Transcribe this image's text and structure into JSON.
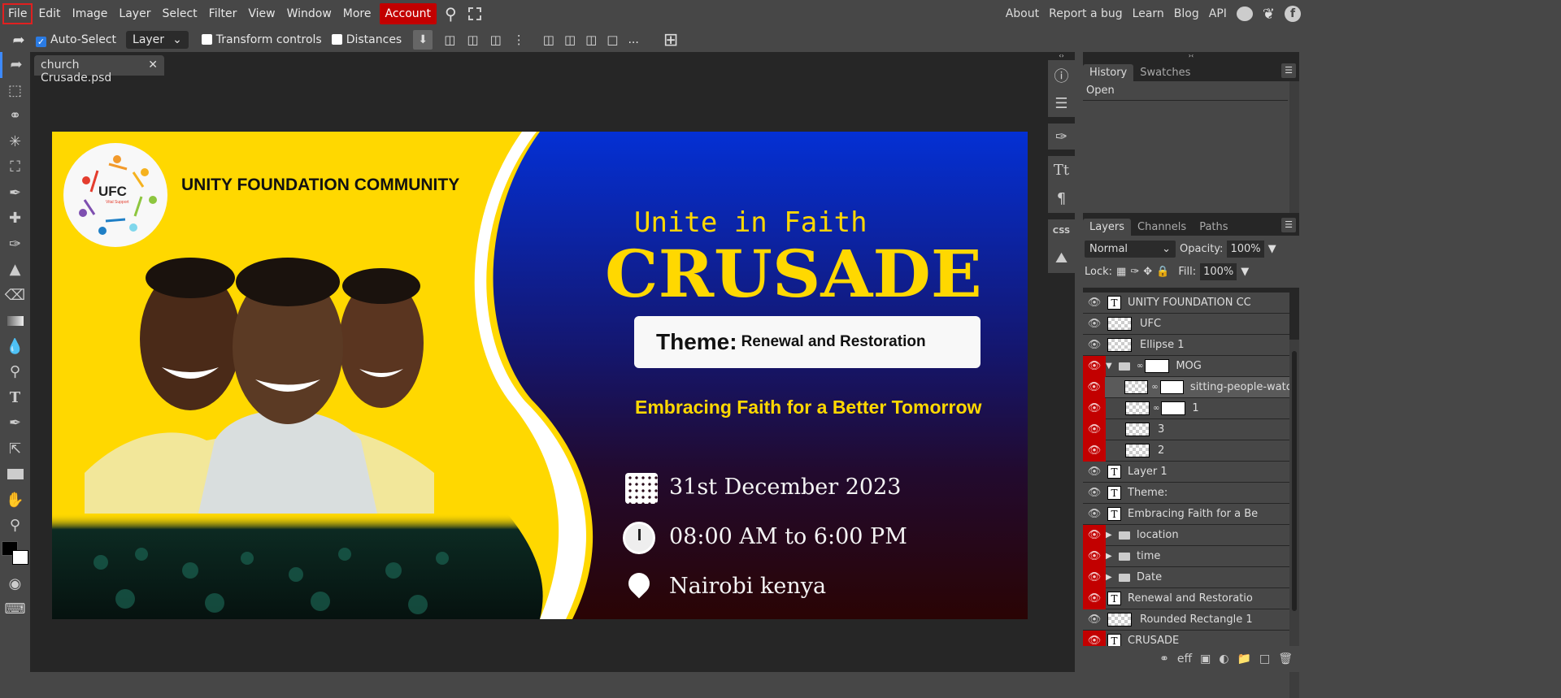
{
  "menu": {
    "items": [
      "File",
      "Edit",
      "Image",
      "Layer",
      "Select",
      "Filter",
      "View",
      "Window",
      "More"
    ],
    "account": "Account",
    "right_links": [
      "About",
      "Report a bug",
      "Learn",
      "Blog",
      "API"
    ]
  },
  "toolbar": {
    "auto_select": "Auto-Select",
    "layer_select": "Layer",
    "transform_controls": "Transform controls",
    "distances": "Distances",
    "more": "..."
  },
  "document": {
    "tab_name": "church Crusade.psd"
  },
  "canvas": {
    "org_name": "UNITY FOUNDATION COMMUNITY",
    "logo_text": "UFC",
    "logo_subtext": "Vital Support",
    "subtitle": "Unite in Faith",
    "title": "CRUSADE",
    "theme_label": "Theme:",
    "theme_value": "Renewal and Restoration",
    "tagline": "Embracing Faith for a Better Tomorrow",
    "date": "31st December 2023",
    "time": "08:00 AM to 6:00 PM",
    "location": "Nairobi kenya",
    "colors": {
      "yellow": "#ffd800",
      "blue": "#0430d4",
      "dark": "#2a0404"
    }
  },
  "history": {
    "tabs": [
      "History",
      "Swatches"
    ],
    "items": [
      "Open"
    ]
  },
  "layers_panel": {
    "tabs": [
      "Layers",
      "Channels",
      "Paths"
    ],
    "blend_mode": "Normal",
    "opacity_label": "Opacity:",
    "opacity": "100%",
    "lock_label": "Lock:",
    "fill_label": "Fill:",
    "fill": "100%",
    "layers": [
      {
        "name": "UNITY FOUNDATION CC",
        "type": "text",
        "red": false,
        "indent": 0
      },
      {
        "name": "UFC",
        "type": "raster",
        "red": false,
        "indent": 0
      },
      {
        "name": "Ellipse 1",
        "type": "raster",
        "red": false,
        "indent": 0
      },
      {
        "name": "MOG",
        "type": "folder-open",
        "red": true,
        "indent": 0
      },
      {
        "name": "sitting-people-watc",
        "type": "raster-mask",
        "red": true,
        "indent": 1,
        "selected": true
      },
      {
        "name": "1",
        "type": "raster-mask",
        "red": true,
        "indent": 1
      },
      {
        "name": "3",
        "type": "raster",
        "red": true,
        "indent": 1
      },
      {
        "name": "2",
        "type": "raster",
        "red": true,
        "indent": 1
      },
      {
        "name": "Layer 1",
        "type": "text",
        "red": false,
        "indent": 0
      },
      {
        "name": "Theme:",
        "type": "text",
        "red": false,
        "indent": 0
      },
      {
        "name": "Embracing Faith for a Be",
        "type": "text",
        "red": false,
        "indent": 0
      },
      {
        "name": "location",
        "type": "folder",
        "red": true,
        "indent": 0
      },
      {
        "name": "time",
        "type": "folder",
        "red": true,
        "indent": 0
      },
      {
        "name": "Date",
        "type": "folder",
        "red": true,
        "indent": 0
      },
      {
        "name": "Renewal and Restoratio",
        "type": "text",
        "red": true,
        "indent": 0
      },
      {
        "name": "Rounded Rectangle 1",
        "type": "raster",
        "red": false,
        "indent": 0
      },
      {
        "name": "CRUSADE",
        "type": "text",
        "red": true,
        "indent": 0
      }
    ],
    "footer_eff": "eff"
  }
}
